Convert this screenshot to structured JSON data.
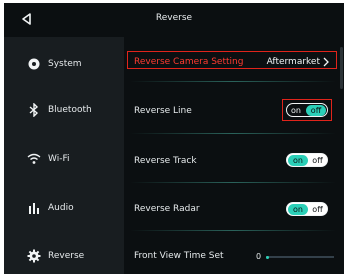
{
  "header": {
    "title": "Reverse"
  },
  "sidebar": {
    "items": [
      {
        "label": "System",
        "icon": "settings-dot-icon"
      },
      {
        "label": "Bluetooth",
        "icon": "bluetooth-icon"
      },
      {
        "label": "Wi-Fi",
        "icon": "wifi-icon"
      },
      {
        "label": "Audio",
        "icon": "equalizer-icon"
      },
      {
        "label": "Reverse",
        "icon": "gear-icon"
      }
    ]
  },
  "settings": {
    "camera": {
      "label": "Reverse Camera Setting",
      "value": "Aftermarket"
    },
    "line": {
      "label": "Reverse Line",
      "on": "on",
      "off": "off"
    },
    "track": {
      "label": "Reverse Track",
      "on": "on",
      "off": "off"
    },
    "radar": {
      "label": "Reverse Radar",
      "on": "on",
      "off": "off"
    },
    "front_view": {
      "label": "Front View Time Set",
      "value": "0"
    }
  },
  "colors": {
    "accent": "#2bd0b8",
    "highlight": "#e0241b",
    "label_red": "#ff3b30"
  }
}
